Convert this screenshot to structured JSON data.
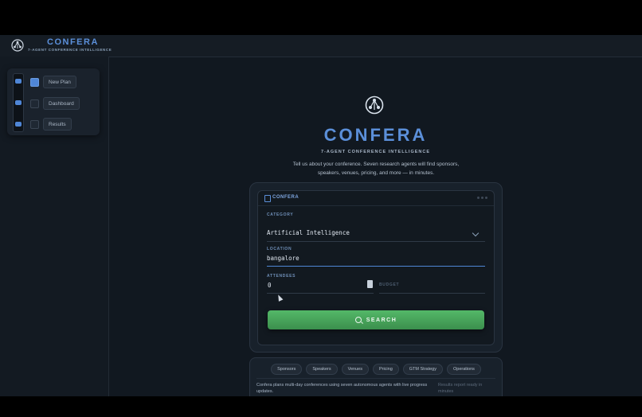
{
  "app": {
    "name": "CONFERA",
    "tagline": "7-AGENT CONFERENCE INTELLIGENCE"
  },
  "sidebar": {
    "items": [
      {
        "label": "New Plan",
        "active": true
      },
      {
        "label": "Dashboard",
        "active": false
      },
      {
        "label": "Results",
        "active": false
      }
    ]
  },
  "hero": {
    "title": "CONFERA",
    "subtitle": "7-AGENT CONFERENCE INTELLIGENCE",
    "description": "Tell us about your conference. Seven research agents will find sponsors, speakers, venues, pricing, and more — in minutes."
  },
  "form": {
    "header_label": "CONFERA",
    "category_label": "CATEGORY",
    "category_value": "Artificial Intelligence",
    "location_label": "LOCATION",
    "location_value": "bangalore",
    "attendees_label": "ATTENDEES",
    "attendees_value": "0",
    "budget_label": "BUDGET",
    "search_label": "SEARCH"
  },
  "info": {
    "chips": [
      "Sponsors",
      "Speakers",
      "Venues",
      "Pricing",
      "GTM Strategy",
      "Operations"
    ],
    "description": "Confera plans multi-day conferences using seven autonomous agents with live progress updates.",
    "note": "Results report ready in minutes"
  },
  "colors": {
    "accent": "#5b8fd9",
    "button": "#4caf5f",
    "background": "#111820"
  },
  "icons": {
    "logo": "network-logo-icon",
    "search": "search-icon",
    "document": "document-icon",
    "chevron": "chevron-down-icon"
  }
}
